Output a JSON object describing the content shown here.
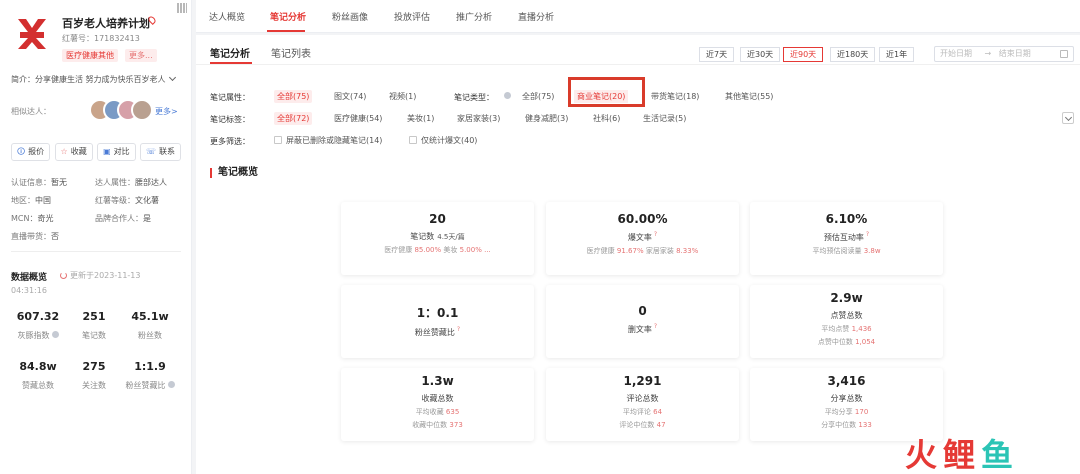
{
  "profile": {
    "name": "百岁老人培养计划",
    "red_id": "红薯号：171832413",
    "tags": [
      "医疗健康其他",
      "更多..."
    ],
    "intro": "简介：分享健康生活 努力成为快乐百岁老人",
    "similar_label": "相似达人：",
    "more_link": "更多>",
    "avatar_colors": [
      "#c9a48a",
      "#7a9ac5",
      "#d6a0a8",
      "#b9a090"
    ],
    "accent": "#e53935"
  },
  "actions": [
    {
      "icon": "🛈",
      "label": "报价"
    },
    {
      "icon": "☆",
      "label": "收藏"
    },
    {
      "icon": "▣",
      "label": "对比"
    },
    {
      "icon": "☏",
      "label": "联系"
    }
  ],
  "info": [
    {
      "k": "认证信息：",
      "v": "暂无"
    },
    {
      "k": "达人属性：",
      "v": "腰部达人"
    },
    {
      "k": "地区：",
      "v": "中国"
    },
    {
      "k": "红薯等级：",
      "v": "文化薯"
    },
    {
      "k": "MCN：",
      "v": "奇光"
    },
    {
      "k": "品牌合作人：",
      "v": "是"
    },
    {
      "k": "直播带货：",
      "v": "否"
    }
  ],
  "data_overview": {
    "title": "数据概览",
    "updated": "更新于2023-11-13",
    "updated_time": "04:31:16",
    "stats": [
      {
        "value": "607.32",
        "label": "灰豚指数",
        "help": true
      },
      {
        "value": "251",
        "label": "笔记数",
        "help": false
      },
      {
        "value": "45.1w",
        "label": "粉丝数",
        "help": false
      },
      {
        "value": "84.8w",
        "label": "赞藏总数",
        "help": false
      },
      {
        "value": "275",
        "label": "关注数",
        "help": false
      },
      {
        "value": "1:1.9",
        "label": "粉丝赞藏比",
        "help": true
      }
    ]
  },
  "top_tabs": [
    "达人概览",
    "笔记分析",
    "粉丝画像",
    "投放评估",
    "推广分析",
    "直播分析"
  ],
  "sub_tabs": [
    "笔记分析",
    "笔记列表"
  ],
  "ranges": [
    "近7天",
    "近30天",
    "近90天",
    "近180天",
    "近1年"
  ],
  "date_picker": {
    "start": "开始日期",
    "arrow": "→",
    "end": "结束日期"
  },
  "filters": {
    "attr_label": "笔记属性：",
    "attr_options": [
      "全部(75)",
      "图文(74)",
      "视频(1)"
    ],
    "type_label": "笔记类型：",
    "type_options": [
      "全部(75)",
      "商业笔记(20)",
      "带货笔记(18)",
      "其他笔记(55)"
    ],
    "tag_label": "笔记标签：",
    "tag_options": [
      "全部(72)",
      "医疗健康(54)",
      "美妆(1)",
      "家居家装(3)",
      "健身减肥(3)",
      "社科(6)",
      "生活记录(5)"
    ],
    "more_label": "更多筛选：",
    "more_options": [
      "屏蔽已删除或隐藏笔记(14)",
      "仅统计爆文(40)"
    ]
  },
  "overview_title": "笔记概览",
  "cards": [
    {
      "value": "20",
      "label": "笔记数",
      "unit": "4.5天/篇",
      "sub": [
        {
          "t": "医疗健康 ",
          "r": "85.00%"
        },
        {
          "t": "  美妆 ",
          "r": "5.00% ..."
        }
      ]
    },
    {
      "value": "60.00%",
      "label": "爆文率",
      "help": true,
      "sub": [
        {
          "t": "医疗健康 ",
          "r": "91.67%"
        },
        {
          "t": "  家居家装 ",
          "r": "8.33%"
        }
      ]
    },
    {
      "value": "6.10%",
      "label": "预估互动率",
      "help": true,
      "sub": [
        {
          "t": "平均预估阅读量 ",
          "r": "3.8w"
        }
      ]
    },
    {
      "value": "1：0.1",
      "label": "粉丝赞藏比",
      "help": true,
      "sub": []
    },
    {
      "value": "0",
      "label": "删文率",
      "help": true,
      "sub": []
    },
    {
      "value": "2.9w",
      "label": "点赞总数",
      "sub": [
        {
          "t": "平均点赞 ",
          "r": "1,436"
        }
      ],
      "sub2": [
        {
          "t": "点赞中位数 ",
          "r": "1,054"
        }
      ]
    },
    {
      "value": "1.3w",
      "label": "收藏总数",
      "sub": [
        {
          "t": "平均收藏 ",
          "r": "635"
        }
      ],
      "sub2": [
        {
          "t": "收藏中位数 ",
          "r": "373"
        }
      ]
    },
    {
      "value": "1,291",
      "label": "评论总数",
      "sub": [
        {
          "t": "平均评论 ",
          "r": "64"
        }
      ],
      "sub2": [
        {
          "t": "评论中位数 ",
          "r": "47"
        }
      ]
    },
    {
      "value": "3,416",
      "label": "分享总数",
      "sub": [
        {
          "t": "平均分享 ",
          "r": "170"
        }
      ],
      "sub2": [
        {
          "t": "分享中位数 ",
          "r": "133"
        }
      ]
    }
  ],
  "watermark": {
    "a": "火",
    "b": "鲤",
    "c": "鱼"
  }
}
